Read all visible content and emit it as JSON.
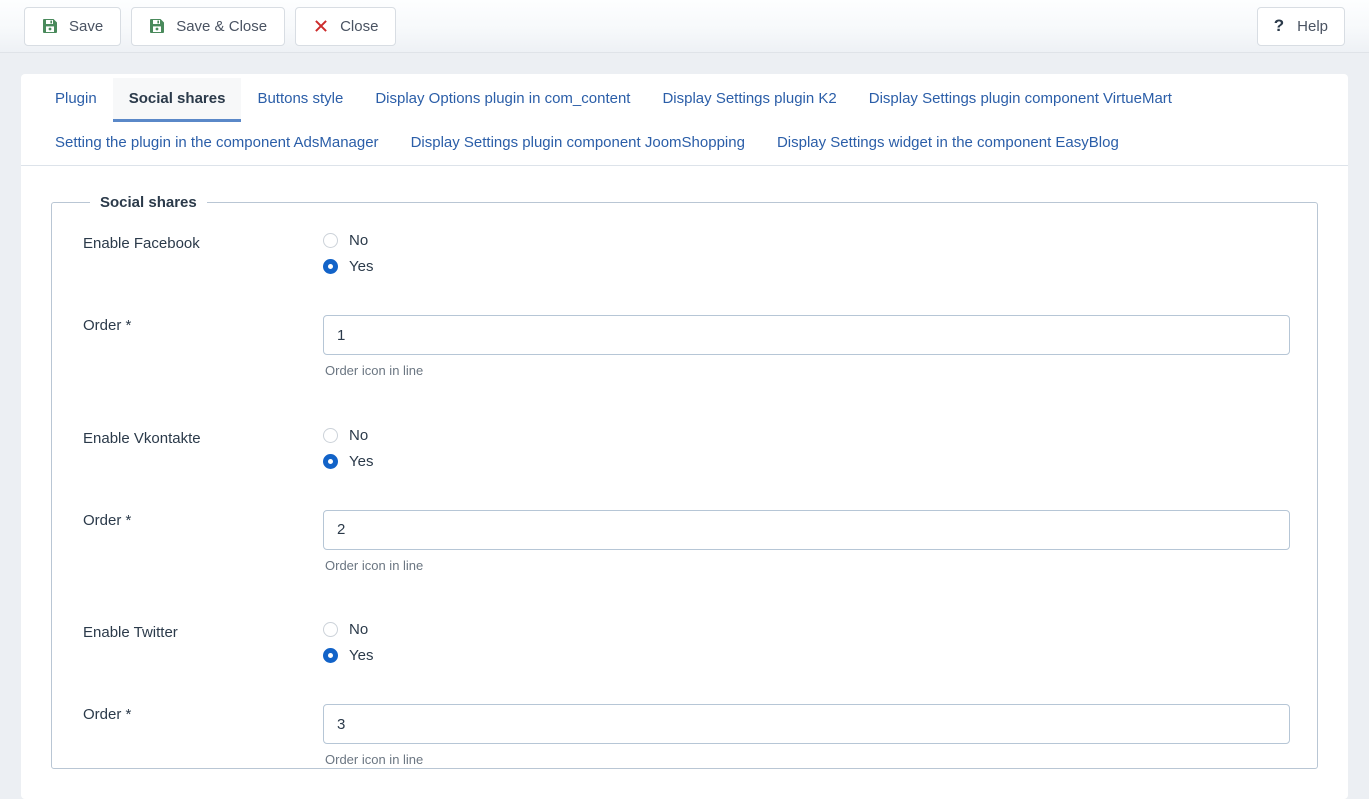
{
  "toolbar": {
    "buttons": [
      {
        "label": "Save",
        "icon": "floppy-disk-icon",
        "icon_color": "#4a8a5c"
      },
      {
        "label": "Save & Close",
        "icon": "floppy-disk-icon",
        "icon_color": "#4a8a5c"
      },
      {
        "label": "Close",
        "icon": "close-x-icon",
        "icon_color": "#cc2b2b"
      }
    ],
    "help": {
      "label": "Help",
      "icon": "question-mark-icon",
      "glyph": "?"
    }
  },
  "tabs": [
    {
      "label": "Plugin",
      "active": false
    },
    {
      "label": "Social shares",
      "active": true
    },
    {
      "label": "Buttons style",
      "active": false
    },
    {
      "label": "Display Options plugin in com_content",
      "active": false
    },
    {
      "label": "Display Settings plugin K2",
      "active": false
    },
    {
      "label": "Display Settings plugin component VirtueMart",
      "active": false
    },
    {
      "label": "Setting the plugin in the component AdsManager",
      "active": false
    },
    {
      "label": "Display Settings plugin component JoomShopping",
      "active": false
    },
    {
      "label": "Display Settings widget in the component EasyBlog",
      "active": false
    }
  ],
  "fieldset": {
    "legend": "Social shares",
    "rows": [
      {
        "type": "radio",
        "label": "Enable Facebook",
        "options": [
          {
            "label": "No",
            "checked": false
          },
          {
            "label": "Yes",
            "checked": true
          }
        ]
      },
      {
        "type": "text",
        "label": "Order",
        "required": true,
        "required_mark": "*",
        "value": "1",
        "placeholder": "",
        "hint": "Order icon in line"
      },
      {
        "type": "radio",
        "label": "Enable Vkontakte",
        "options": [
          {
            "label": "No",
            "checked": false
          },
          {
            "label": "Yes",
            "checked": true
          }
        ]
      },
      {
        "type": "text",
        "label": "Order",
        "required": true,
        "required_mark": "*",
        "value": "2",
        "placeholder": "",
        "hint": "Order icon in line"
      },
      {
        "type": "radio",
        "label": "Enable Twitter",
        "options": [
          {
            "label": "No",
            "checked": false
          },
          {
            "label": "Yes",
            "checked": true
          }
        ]
      },
      {
        "type": "text",
        "label": "Order",
        "required": true,
        "required_mark": "*",
        "value": "3",
        "placeholder": "",
        "hint": "Order icon in line"
      }
    ]
  },
  "colors": {
    "accent_blue": "#1263c8",
    "tab_link": "#2b5ea8",
    "tab_underline": "#5a88c8",
    "save_green": "#4a8a5c",
    "close_red": "#cc2b2b",
    "text": "#2b3a4a",
    "page_bg": "#eceff3"
  }
}
